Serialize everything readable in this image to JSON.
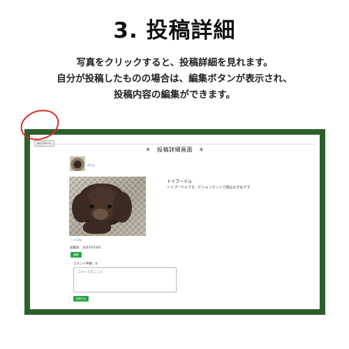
{
  "heading": "3. 投稿詳細",
  "description": [
    "写真をクリックすると、投稿詳細を見れます。",
    "自分が投稿したものの場合は、編集ボタンが表示され、",
    "投稿内容の編集ができます。"
  ],
  "screenshot": {
    "back_button": "戻る(Back)",
    "page_title": "＊　投稿詳細画面　＊",
    "user_name": "ぷりん",
    "post": {
      "title": "トイプードル",
      "body": "トイプードルです。ビションカットで顔は大きめです"
    },
    "like_link": "♡ いいね",
    "post_date": "投稿日：2023/07/04",
    "edit_button": "編集",
    "comment_label": "コメント件数：0",
    "comment_placeholder": "コメントをここに",
    "submit_button": "送信する"
  },
  "colors": {
    "frame": "#2d5e2b",
    "button": "#28a745",
    "link": "#3366cc",
    "highlight_circle": "#e02424"
  }
}
